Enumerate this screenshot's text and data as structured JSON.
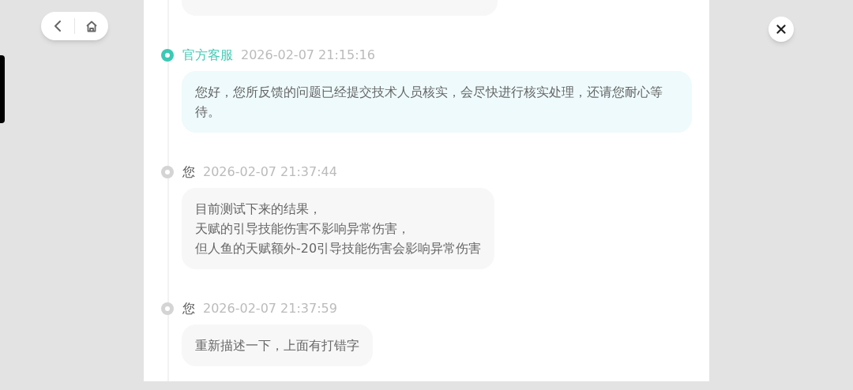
{
  "messages": [
    {
      "kind": "staff",
      "author": "官方客服",
      "time": "2026-02-07 21:15:16",
      "color": "#3cc9b4",
      "lines": [
        "您好，您所反馈的问题已经提交技术人员核实，会尽快进行核实处理，还请您耐心等待。"
      ]
    },
    {
      "kind": "user",
      "author": "您",
      "time": "2026-02-07 21:37:44",
      "color": "#d4d4d4",
      "lines": [
        "目前测试下来的结果，",
        "天赋的引导技能伤害不影响异常伤害，",
        "但人鱼的天赋额外-20引导技能伤害会影响异常伤害"
      ]
    },
    {
      "kind": "user",
      "author": "您",
      "time": "2026-02-07 21:37:59",
      "color": "#d4d4d4",
      "lines": [
        "重新描述一下，上面有打错字"
      ]
    }
  ]
}
